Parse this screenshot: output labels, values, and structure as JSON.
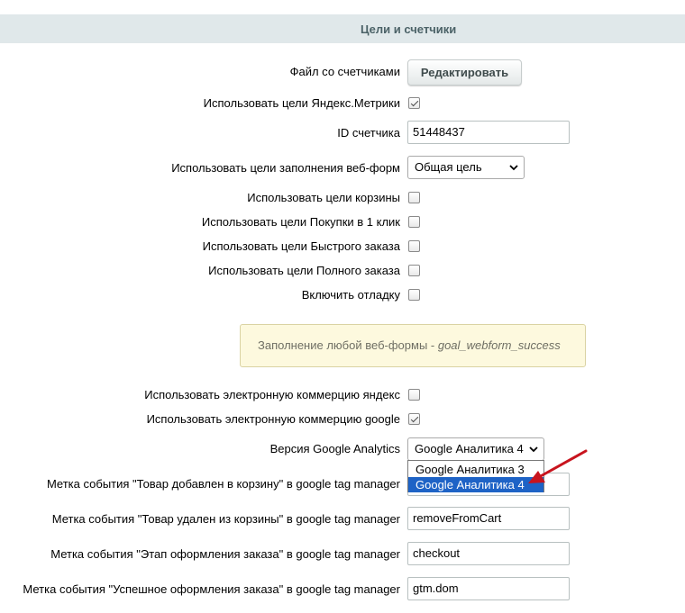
{
  "section": {
    "title": "Цели и счетчики"
  },
  "counters_file": {
    "label": "Файл со счетчиками",
    "button_label": "Редактировать"
  },
  "use_metrika_goals": {
    "label": "Использовать цели Яндекс.Метрики",
    "checked": true
  },
  "counter_id": {
    "label": "ID счетчика",
    "value": "51448437"
  },
  "webform_goals": {
    "label": "Использовать цели заполнения веб-форм",
    "selected": "Общая цель"
  },
  "basket_goals": {
    "label": "Использовать цели корзины",
    "checked": false
  },
  "one_click_goals": {
    "label": "Использовать цели Покупки в 1 клик",
    "checked": false
  },
  "quick_order_goals": {
    "label": "Использовать цели Быстрого заказа",
    "checked": false
  },
  "full_order_goals": {
    "label": "Использовать цели Полного заказа",
    "checked": false
  },
  "debug": {
    "label": "Включить отладку",
    "checked": false
  },
  "hint": {
    "text": "Заполнение любой веб-формы - ",
    "code": "goal_webform_success"
  },
  "yandex_ecommerce": {
    "label": "Использовать электронную коммерцию яндекс",
    "checked": false
  },
  "google_ecommerce": {
    "label": "Использовать электронную коммерцию google",
    "checked": true
  },
  "ga_version": {
    "label": "Версия Google Analytics",
    "selected": "Google Аналитика 4",
    "options": [
      "Google Аналитика 3",
      "Google Аналитика 4"
    ],
    "highlighted_index": 1
  },
  "gtm_add_to_cart": {
    "label": "Метка события \"Товар добавлен в корзину\" в google tag manager",
    "value": ""
  },
  "gtm_remove_from_cart": {
    "label": "Метка события \"Товар удален из корзины\" в google tag manager",
    "value": "removeFromCart"
  },
  "gtm_checkout": {
    "label": "Метка события \"Этап оформления заказа\" в google tag manager",
    "value": "checkout"
  },
  "gtm_order_success": {
    "label": "Метка события \"Успешное оформления заказа\" в google tag manager",
    "value": "gtm.dom"
  },
  "colors": {
    "arrow": "#c8141e",
    "highlight": "#1e63c6",
    "header_bg": "#e0e8ea",
    "hint_bg": "#fdf9de"
  }
}
